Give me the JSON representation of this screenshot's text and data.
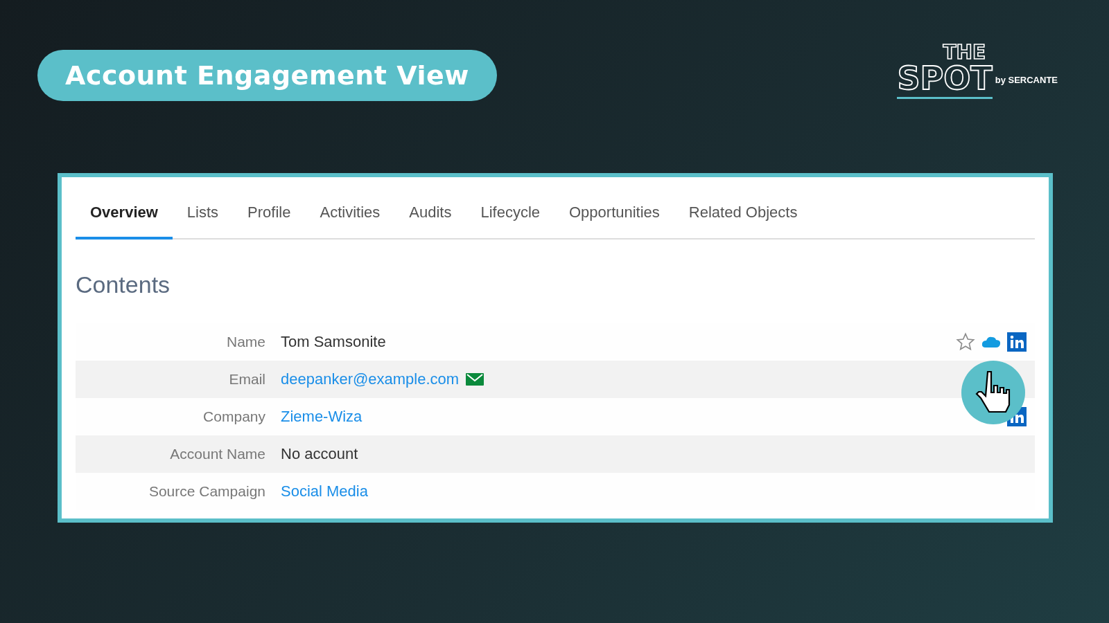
{
  "slide_title": "Account Engagement View",
  "logo": {
    "top": "THE",
    "main": "SPOT",
    "by": "by SERCANTE"
  },
  "tabs": [
    {
      "label": "Overview",
      "selected": true
    },
    {
      "label": "Lists",
      "selected": false
    },
    {
      "label": "Profile",
      "selected": false
    },
    {
      "label": "Activities",
      "selected": false
    },
    {
      "label": "Audits",
      "selected": false
    },
    {
      "label": "Lifecycle",
      "selected": false
    },
    {
      "label": "Opportunities",
      "selected": false
    },
    {
      "label": "Related Objects",
      "selected": false
    }
  ],
  "section_title": "Contents",
  "fields": [
    {
      "label": "Name",
      "value": "Tom Samsonite",
      "kind": "text",
      "mail_icon": false,
      "action_icons": true,
      "linkedin_icon": false
    },
    {
      "label": "Email",
      "value": "deepanker@example.com",
      "kind": "link",
      "mail_icon": true,
      "action_icons": false,
      "linkedin_icon": false
    },
    {
      "label": "Company",
      "value": "Zieme-Wiza",
      "kind": "link",
      "mail_icon": false,
      "action_icons": false,
      "linkedin_icon": true
    },
    {
      "label": "Account Name",
      "value": "No account",
      "kind": "text",
      "mail_icon": false,
      "action_icons": false,
      "linkedin_icon": false
    },
    {
      "label": "Source Campaign",
      "value": "Social Media",
      "kind": "link",
      "mail_icon": false,
      "action_icons": false,
      "linkedin_icon": false
    }
  ]
}
